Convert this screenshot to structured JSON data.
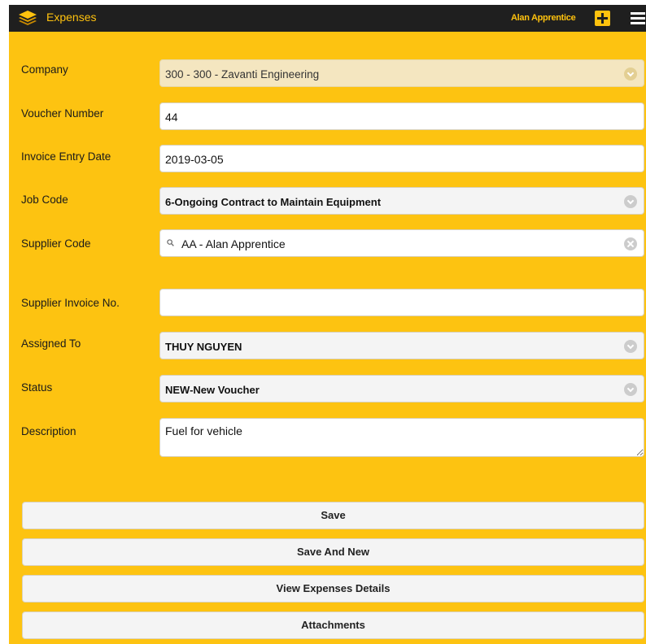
{
  "header": {
    "title": "Expenses",
    "user": "Alan Apprentice"
  },
  "form": {
    "company": {
      "label": "Company",
      "value": "300 - 300 - Zavanti Engineering"
    },
    "voucher_number": {
      "label": "Voucher Number",
      "value": "44"
    },
    "invoice_entry_date": {
      "label": "Invoice Entry Date",
      "value": "2019-03-05"
    },
    "job_code": {
      "label": "Job Code",
      "value": "6-Ongoing Contract to Maintain Equipment"
    },
    "supplier_code": {
      "label": "Supplier Code",
      "value": "AA - Alan Apprentice"
    },
    "supplier_invoice_no": {
      "label": "Supplier Invoice No.",
      "value": ""
    },
    "assigned_to": {
      "label": "Assigned To",
      "value": "THUY NGUYEN"
    },
    "status": {
      "label": "Status",
      "value": "NEW-New Voucher"
    },
    "description": {
      "label": "Description",
      "value": "Fuel for vehicle"
    }
  },
  "buttons": {
    "save": "Save",
    "save_and_new": "Save And New",
    "view_details": "View Expenses Details",
    "attachments": "Attachments"
  },
  "colors": {
    "accent": "#fdc311",
    "header_bg": "#1f1f1f",
    "header_text": "#ffc20e"
  }
}
